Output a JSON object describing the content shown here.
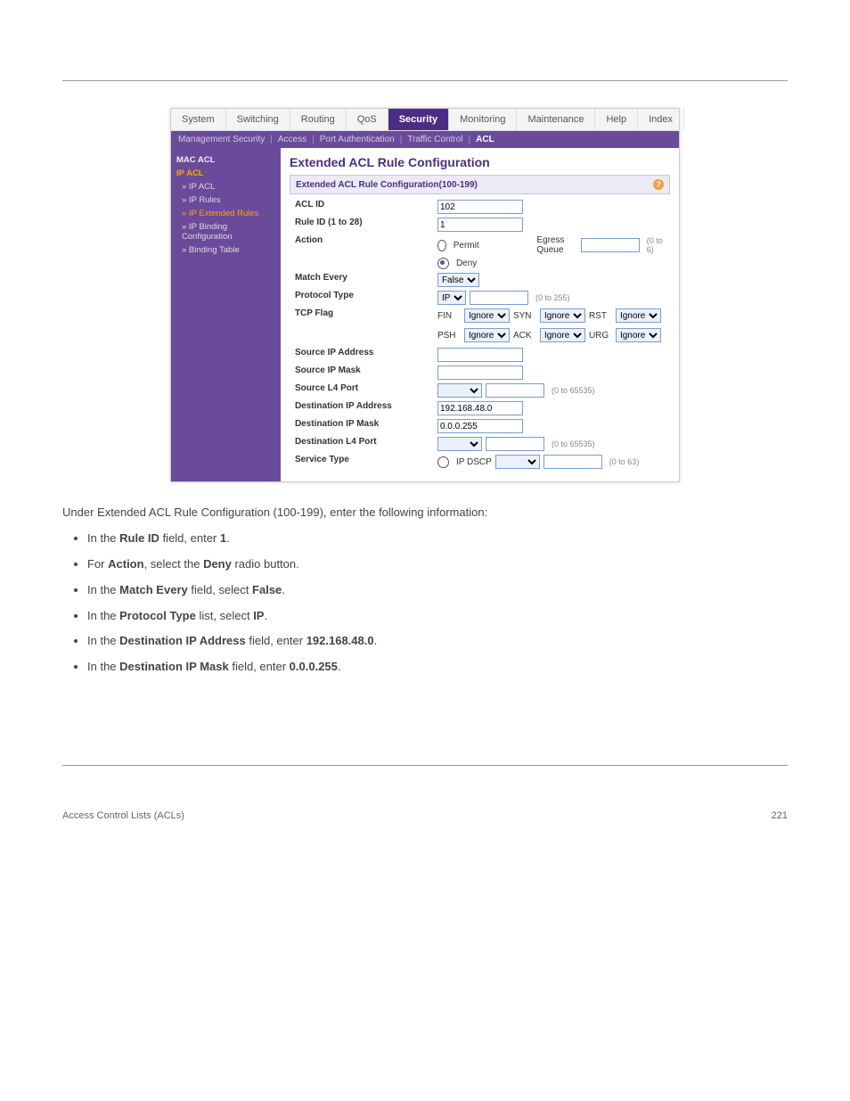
{
  "header_identity": "",
  "topnav": [
    "System",
    "Switching",
    "Routing",
    "QoS",
    "Security",
    "Monitoring",
    "Maintenance",
    "Help",
    "Index"
  ],
  "topnav_active_index": 4,
  "subnav": [
    {
      "label": "Management Security",
      "sel": false
    },
    {
      "label": "Access",
      "sel": false
    },
    {
      "label": "Port Authentication",
      "sel": false
    },
    {
      "label": "Traffic Control",
      "sel": false
    },
    {
      "label": "ACL",
      "sel": true
    }
  ],
  "sidenav": {
    "items": [
      {
        "label": "MAC ACL",
        "cls": "top-item"
      },
      {
        "label": "IP ACL",
        "cls": "sel-item"
      },
      {
        "label": "» IP ACL",
        "cls": "child"
      },
      {
        "label": "» IP Rules",
        "cls": "child"
      },
      {
        "label": "» IP Extended Rules",
        "cls": "child sel"
      },
      {
        "label": "» IP Binding Configuration",
        "cls": "child"
      },
      {
        "label": "» Binding Table",
        "cls": "child"
      }
    ]
  },
  "main": {
    "title": "Extended ACL Rule Configuration",
    "panel_head": "Extended ACL Rule Configuration(100-199)",
    "rows": {
      "acl_id": {
        "label": "ACL ID",
        "value": "102"
      },
      "rule_id": {
        "label": "Rule ID (1 to 28)",
        "value": "1"
      },
      "action": {
        "label": "Action",
        "permit": "Permit",
        "deny": "Deny",
        "egress": "Egress Queue",
        "egress_hint": "(0 to 6)"
      },
      "match_every": {
        "label": "Match Every",
        "value": "False"
      },
      "protocol_type": {
        "label": "Protocol Type",
        "value": "IP",
        "hint": "(0 to 255)"
      },
      "tcp_flag": {
        "label": "TCP Flag",
        "row1": [
          {
            "tag": "FIN",
            "val": "Ignore"
          },
          {
            "tag": "SYN",
            "val": "Ignore"
          },
          {
            "tag": "RST",
            "val": "Ignore"
          }
        ],
        "row2": [
          {
            "tag": "PSH",
            "val": "Ignore"
          },
          {
            "tag": "ACK",
            "val": "Ignore"
          },
          {
            "tag": "URG",
            "val": "Ignore"
          }
        ]
      },
      "src_ip": {
        "label": "Source IP Address",
        "value": ""
      },
      "src_mask": {
        "label": "Source IP Mask",
        "value": ""
      },
      "src_l4": {
        "label": "Source L4 Port",
        "value": "",
        "hint": "(0 to 65535)"
      },
      "dst_ip": {
        "label": "Destination IP Address",
        "value": "192.168.48.0"
      },
      "dst_mask": {
        "label": "Destination IP Mask",
        "value": "0.0.0.255"
      },
      "dst_l4": {
        "label": "Destination L4 Port",
        "value": "",
        "hint": "(0 to 65535)"
      },
      "svc_type": {
        "label": "Service Type",
        "opt": "IP DSCP",
        "hint": "(0 to 63)"
      }
    }
  },
  "intro_line": "Under Extended ACL Rule Configuration (100-199), enter the following information:",
  "bullets": [
    {
      "k": "Rule ID",
      "v": "1"
    },
    {
      "k": "Action",
      "v": "Deny"
    },
    {
      "k": "Match Every",
      "v": "False"
    },
    {
      "k": "Protocol Type",
      "v": "IP"
    },
    {
      "k": "Destination IP Address",
      "v": "192.168.48.0"
    },
    {
      "k": "Destination IP Mask",
      "v": "0.0.0.255"
    }
  ],
  "bullet_field_word": "field, select",
  "bullet_field_word_enter": "field, enter",
  "bullet_list_word": "list, select",
  "footer_left": "Access Control Lists (ACLs)",
  "footer_right": "221"
}
